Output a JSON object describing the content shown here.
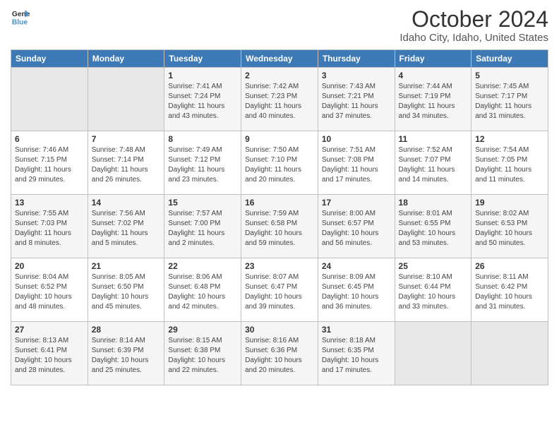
{
  "header": {
    "logo": {
      "line1": "General",
      "line2": "Blue"
    },
    "title": "October 2024",
    "subtitle": "Idaho City, Idaho, United States"
  },
  "days_of_week": [
    "Sunday",
    "Monday",
    "Tuesday",
    "Wednesday",
    "Thursday",
    "Friday",
    "Saturday"
  ],
  "weeks": [
    [
      {
        "day": "",
        "empty": true
      },
      {
        "day": "",
        "empty": true
      },
      {
        "day": "1",
        "sunrise": "Sunrise: 7:41 AM",
        "sunset": "Sunset: 7:24 PM",
        "daylight": "Daylight: 11 hours and 43 minutes."
      },
      {
        "day": "2",
        "sunrise": "Sunrise: 7:42 AM",
        "sunset": "Sunset: 7:23 PM",
        "daylight": "Daylight: 11 hours and 40 minutes."
      },
      {
        "day": "3",
        "sunrise": "Sunrise: 7:43 AM",
        "sunset": "Sunset: 7:21 PM",
        "daylight": "Daylight: 11 hours and 37 minutes."
      },
      {
        "day": "4",
        "sunrise": "Sunrise: 7:44 AM",
        "sunset": "Sunset: 7:19 PM",
        "daylight": "Daylight: 11 hours and 34 minutes."
      },
      {
        "day": "5",
        "sunrise": "Sunrise: 7:45 AM",
        "sunset": "Sunset: 7:17 PM",
        "daylight": "Daylight: 11 hours and 31 minutes."
      }
    ],
    [
      {
        "day": "6",
        "sunrise": "Sunrise: 7:46 AM",
        "sunset": "Sunset: 7:15 PM",
        "daylight": "Daylight: 11 hours and 29 minutes."
      },
      {
        "day": "7",
        "sunrise": "Sunrise: 7:48 AM",
        "sunset": "Sunset: 7:14 PM",
        "daylight": "Daylight: 11 hours and 26 minutes."
      },
      {
        "day": "8",
        "sunrise": "Sunrise: 7:49 AM",
        "sunset": "Sunset: 7:12 PM",
        "daylight": "Daylight: 11 hours and 23 minutes."
      },
      {
        "day": "9",
        "sunrise": "Sunrise: 7:50 AM",
        "sunset": "Sunset: 7:10 PM",
        "daylight": "Daylight: 11 hours and 20 minutes."
      },
      {
        "day": "10",
        "sunrise": "Sunrise: 7:51 AM",
        "sunset": "Sunset: 7:08 PM",
        "daylight": "Daylight: 11 hours and 17 minutes."
      },
      {
        "day": "11",
        "sunrise": "Sunrise: 7:52 AM",
        "sunset": "Sunset: 7:07 PM",
        "daylight": "Daylight: 11 hours and 14 minutes."
      },
      {
        "day": "12",
        "sunrise": "Sunrise: 7:54 AM",
        "sunset": "Sunset: 7:05 PM",
        "daylight": "Daylight: 11 hours and 11 minutes."
      }
    ],
    [
      {
        "day": "13",
        "sunrise": "Sunrise: 7:55 AM",
        "sunset": "Sunset: 7:03 PM",
        "daylight": "Daylight: 11 hours and 8 minutes."
      },
      {
        "day": "14",
        "sunrise": "Sunrise: 7:56 AM",
        "sunset": "Sunset: 7:02 PM",
        "daylight": "Daylight: 11 hours and 5 minutes."
      },
      {
        "day": "15",
        "sunrise": "Sunrise: 7:57 AM",
        "sunset": "Sunset: 7:00 PM",
        "daylight": "Daylight: 11 hours and 2 minutes."
      },
      {
        "day": "16",
        "sunrise": "Sunrise: 7:59 AM",
        "sunset": "Sunset: 6:58 PM",
        "daylight": "Daylight: 10 hours and 59 minutes."
      },
      {
        "day": "17",
        "sunrise": "Sunrise: 8:00 AM",
        "sunset": "Sunset: 6:57 PM",
        "daylight": "Daylight: 10 hours and 56 minutes."
      },
      {
        "day": "18",
        "sunrise": "Sunrise: 8:01 AM",
        "sunset": "Sunset: 6:55 PM",
        "daylight": "Daylight: 10 hours and 53 minutes."
      },
      {
        "day": "19",
        "sunrise": "Sunrise: 8:02 AM",
        "sunset": "Sunset: 6:53 PM",
        "daylight": "Daylight: 10 hours and 50 minutes."
      }
    ],
    [
      {
        "day": "20",
        "sunrise": "Sunrise: 8:04 AM",
        "sunset": "Sunset: 6:52 PM",
        "daylight": "Daylight: 10 hours and 48 minutes."
      },
      {
        "day": "21",
        "sunrise": "Sunrise: 8:05 AM",
        "sunset": "Sunset: 6:50 PM",
        "daylight": "Daylight: 10 hours and 45 minutes."
      },
      {
        "day": "22",
        "sunrise": "Sunrise: 8:06 AM",
        "sunset": "Sunset: 6:48 PM",
        "daylight": "Daylight: 10 hours and 42 minutes."
      },
      {
        "day": "23",
        "sunrise": "Sunrise: 8:07 AM",
        "sunset": "Sunset: 6:47 PM",
        "daylight": "Daylight: 10 hours and 39 minutes."
      },
      {
        "day": "24",
        "sunrise": "Sunrise: 8:09 AM",
        "sunset": "Sunset: 6:45 PM",
        "daylight": "Daylight: 10 hours and 36 minutes."
      },
      {
        "day": "25",
        "sunrise": "Sunrise: 8:10 AM",
        "sunset": "Sunset: 6:44 PM",
        "daylight": "Daylight: 10 hours and 33 minutes."
      },
      {
        "day": "26",
        "sunrise": "Sunrise: 8:11 AM",
        "sunset": "Sunset: 6:42 PM",
        "daylight": "Daylight: 10 hours and 31 minutes."
      }
    ],
    [
      {
        "day": "27",
        "sunrise": "Sunrise: 8:13 AM",
        "sunset": "Sunset: 6:41 PM",
        "daylight": "Daylight: 10 hours and 28 minutes."
      },
      {
        "day": "28",
        "sunrise": "Sunrise: 8:14 AM",
        "sunset": "Sunset: 6:39 PM",
        "daylight": "Daylight: 10 hours and 25 minutes."
      },
      {
        "day": "29",
        "sunrise": "Sunrise: 8:15 AM",
        "sunset": "Sunset: 6:38 PM",
        "daylight": "Daylight: 10 hours and 22 minutes."
      },
      {
        "day": "30",
        "sunrise": "Sunrise: 8:16 AM",
        "sunset": "Sunset: 6:36 PM",
        "daylight": "Daylight: 10 hours and 20 minutes."
      },
      {
        "day": "31",
        "sunrise": "Sunrise: 8:18 AM",
        "sunset": "Sunset: 6:35 PM",
        "daylight": "Daylight: 10 hours and 17 minutes."
      },
      {
        "day": "",
        "empty": true
      },
      {
        "day": "",
        "empty": true
      }
    ]
  ]
}
